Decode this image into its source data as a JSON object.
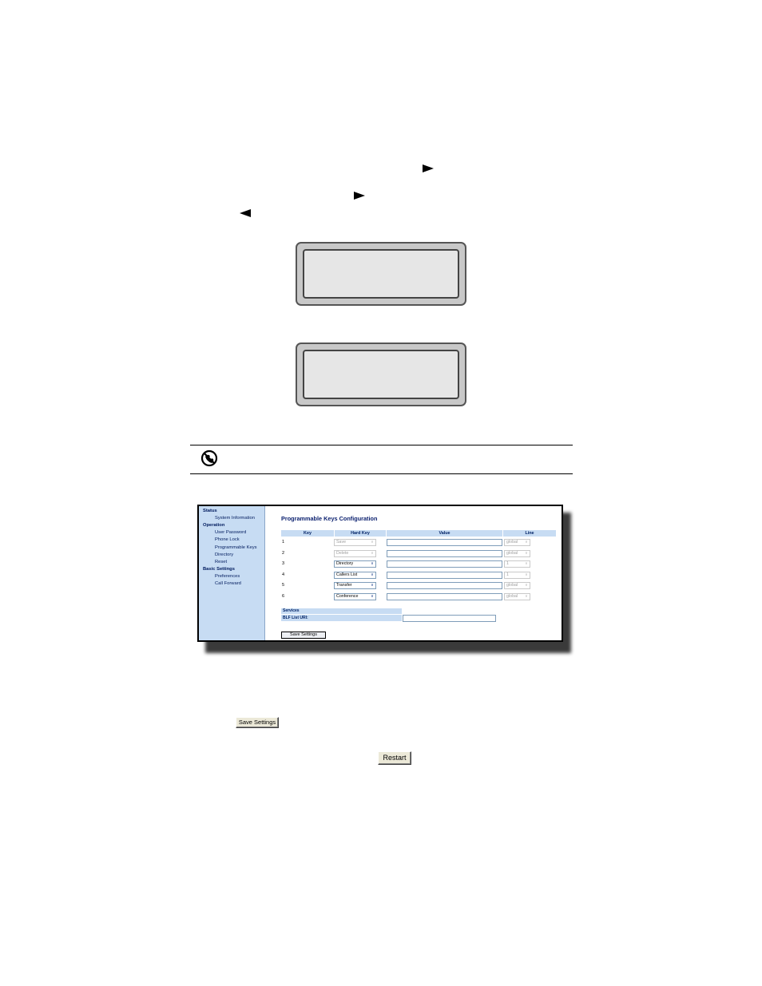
{
  "web_ui": {
    "sidebar": [
      {
        "label": "Status",
        "level": "head"
      },
      {
        "label": "System Information",
        "level": "sub"
      },
      {
        "label": "Operation",
        "level": "head"
      },
      {
        "label": "User Password",
        "level": "sub"
      },
      {
        "label": "Phone Lock",
        "level": "sub"
      },
      {
        "label": "Programmable Keys",
        "level": "sub"
      },
      {
        "label": "Directory",
        "level": "sub"
      },
      {
        "label": "Reset",
        "level": "sub"
      },
      {
        "label": "Basic Settings",
        "level": "head"
      },
      {
        "label": "Preferences",
        "level": "sub"
      },
      {
        "label": "Call Forward",
        "level": "sub"
      }
    ],
    "page_title": "Programmable Keys Configuration",
    "columns": {
      "key": "Key",
      "hard_key": "Hard Key",
      "value": "Value",
      "line": "Line"
    },
    "rows": [
      {
        "key": "1",
        "hard_key": "Save",
        "hard_key_disabled": true,
        "line": "global"
      },
      {
        "key": "2",
        "hard_key": "Delete",
        "hard_key_disabled": true,
        "line": "global"
      },
      {
        "key": "3",
        "hard_key": "Directory",
        "hard_key_disabled": false,
        "line": "1"
      },
      {
        "key": "4",
        "hard_key": "Callers List",
        "hard_key_disabled": false,
        "line": "1"
      },
      {
        "key": "5",
        "hard_key": "Transfer",
        "hard_key_disabled": false,
        "line": "global"
      },
      {
        "key": "6",
        "hard_key": "Conference",
        "hard_key_disabled": false,
        "line": "global"
      }
    ],
    "services_header": "Services",
    "blf_label": "BLF List URI:",
    "save_button": "Save Settings"
  },
  "save_settings_button": "Save Settings",
  "restart_button": "Restart",
  "icons": {
    "note": "no-symbol-phone-icon",
    "dropdown": "chevron-down-icon",
    "arrow_right": "right-arrow-key-icon",
    "arrow_left": "left-arrow-key-icon"
  }
}
